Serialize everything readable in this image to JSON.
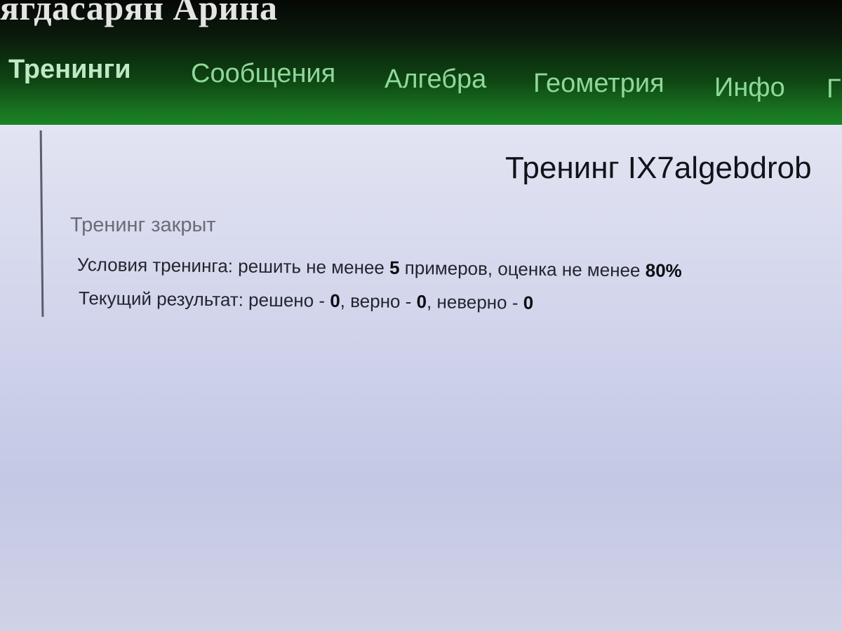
{
  "header": {
    "user_name": "ягдасарян Арина"
  },
  "nav": {
    "items": [
      {
        "label": "Тренинги",
        "active": true
      },
      {
        "label": "Сообщения",
        "active": false
      },
      {
        "label": "Алгебра",
        "active": false
      },
      {
        "label": "Геометрия",
        "active": false
      },
      {
        "label": "Инфо",
        "active": false
      },
      {
        "label": "Г",
        "active": false
      }
    ]
  },
  "main": {
    "title": "Тренинг IX7algebdrob",
    "status": "Тренинг закрыт",
    "conditions": {
      "prefix": "Условия тренинга: решить не менее ",
      "min_examples": "5",
      "middle": " примеров, оценка не менее ",
      "min_score": "80%"
    },
    "result": {
      "prefix": "Текущий результат: решено - ",
      "solved": "0",
      "correct_label": ", верно - ",
      "correct": "0",
      "incorrect_label": ", неверно - ",
      "incorrect": "0"
    }
  }
}
